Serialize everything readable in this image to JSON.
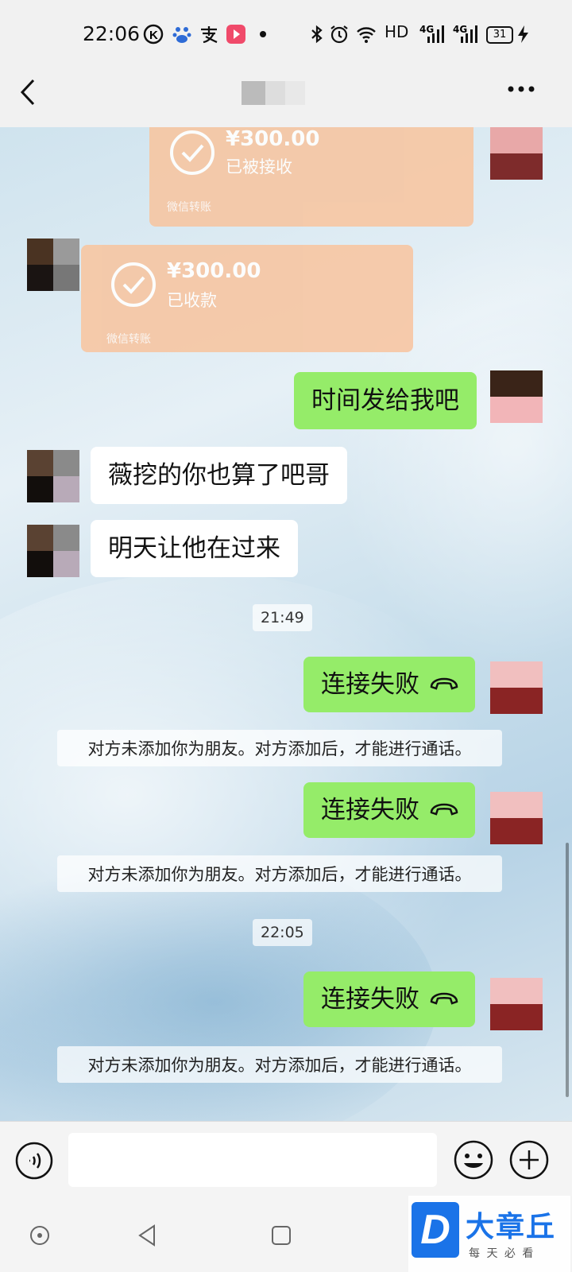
{
  "status_bar": {
    "time": "22:06",
    "net_label": "HD",
    "sig1": "4G",
    "sig2": "4G",
    "battery": "31",
    "icons": [
      "k-app-icon",
      "baidu-icon",
      "alipay-icon",
      "video-app-icon",
      "dot-icon",
      "bluetooth-icon",
      "alarm-icon",
      "wifi-icon",
      "signal-icon",
      "battery-icon",
      "charging-icon"
    ]
  },
  "nav": {
    "back_icon": "back-chevron-icon",
    "more_icon": "more-dots-icon"
  },
  "messages": {
    "transfer_sent": {
      "amount": "¥300.00",
      "status": "已被接收",
      "footer": "微信转账"
    },
    "transfer_received": {
      "amount": "¥300.00",
      "status": "已收款",
      "footer": "微信转账"
    },
    "m1": "时间发给我吧",
    "m2": "薇挖的你也算了吧哥",
    "m3": "明天让他在过来",
    "ts1": "21:49",
    "call1": "连接失败",
    "sys1": "对方未添加你为朋友。对方添加后，才能进行通话。",
    "call2": "连接失败",
    "sys2": "对方未添加你为朋友。对方添加后，才能进行通话。",
    "ts2": "22:05",
    "call3": "连接失败",
    "sys3": "对方未添加你为朋友。对方添加后，才能进行通话。"
  },
  "input_bar": {
    "voice_icon": "voice-icon",
    "emoji_icon": "emoji-icon",
    "plus_icon": "plus-icon",
    "text": ""
  },
  "watermark": {
    "name": "大章丘",
    "slogan": "每 天 必 看",
    "letter": "D"
  },
  "colors": {
    "bubble_green": "#95ec69",
    "transfer": "#f6c7a4",
    "watermark_blue": "#1a73e8"
  }
}
